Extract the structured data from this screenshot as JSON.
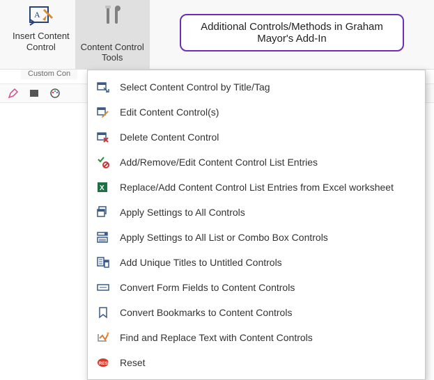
{
  "ribbon": {
    "insert_content_control": "Insert Content\nControl",
    "content_control_tools": "Content Control\nTools",
    "group_caption": "Custom Con"
  },
  "callout": {
    "text": "Additional Controls/Methods in Graham Mayor's Add-In"
  },
  "menu": {
    "items": [
      {
        "id": "select-by-title",
        "label": "Select Content Control by Title/Tag"
      },
      {
        "id": "edit-controls",
        "label": "Edit Content Control(s)"
      },
      {
        "id": "delete-control",
        "label": "Delete Content Control"
      },
      {
        "id": "list-entries",
        "label": "Add/Remove/Edit Content Control List Entries"
      },
      {
        "id": "replace-excel",
        "label": "Replace/Add Content Control List Entries from Excel worksheet"
      },
      {
        "id": "apply-all",
        "label": "Apply Settings to All Controls"
      },
      {
        "id": "apply-list-combo",
        "label": "Apply Settings to All List or Combo Box Controls"
      },
      {
        "id": "unique-titles",
        "label": "Add Unique Titles to Untitled Controls"
      },
      {
        "id": "convert-form",
        "label": "Convert Form Fields to Content Controls"
      },
      {
        "id": "convert-bookmarks",
        "label": "Convert Bookmarks to Content Controls"
      },
      {
        "id": "find-replace",
        "label": "Find and Replace Text with Content Controls"
      },
      {
        "id": "reset",
        "label": "Reset"
      }
    ]
  }
}
